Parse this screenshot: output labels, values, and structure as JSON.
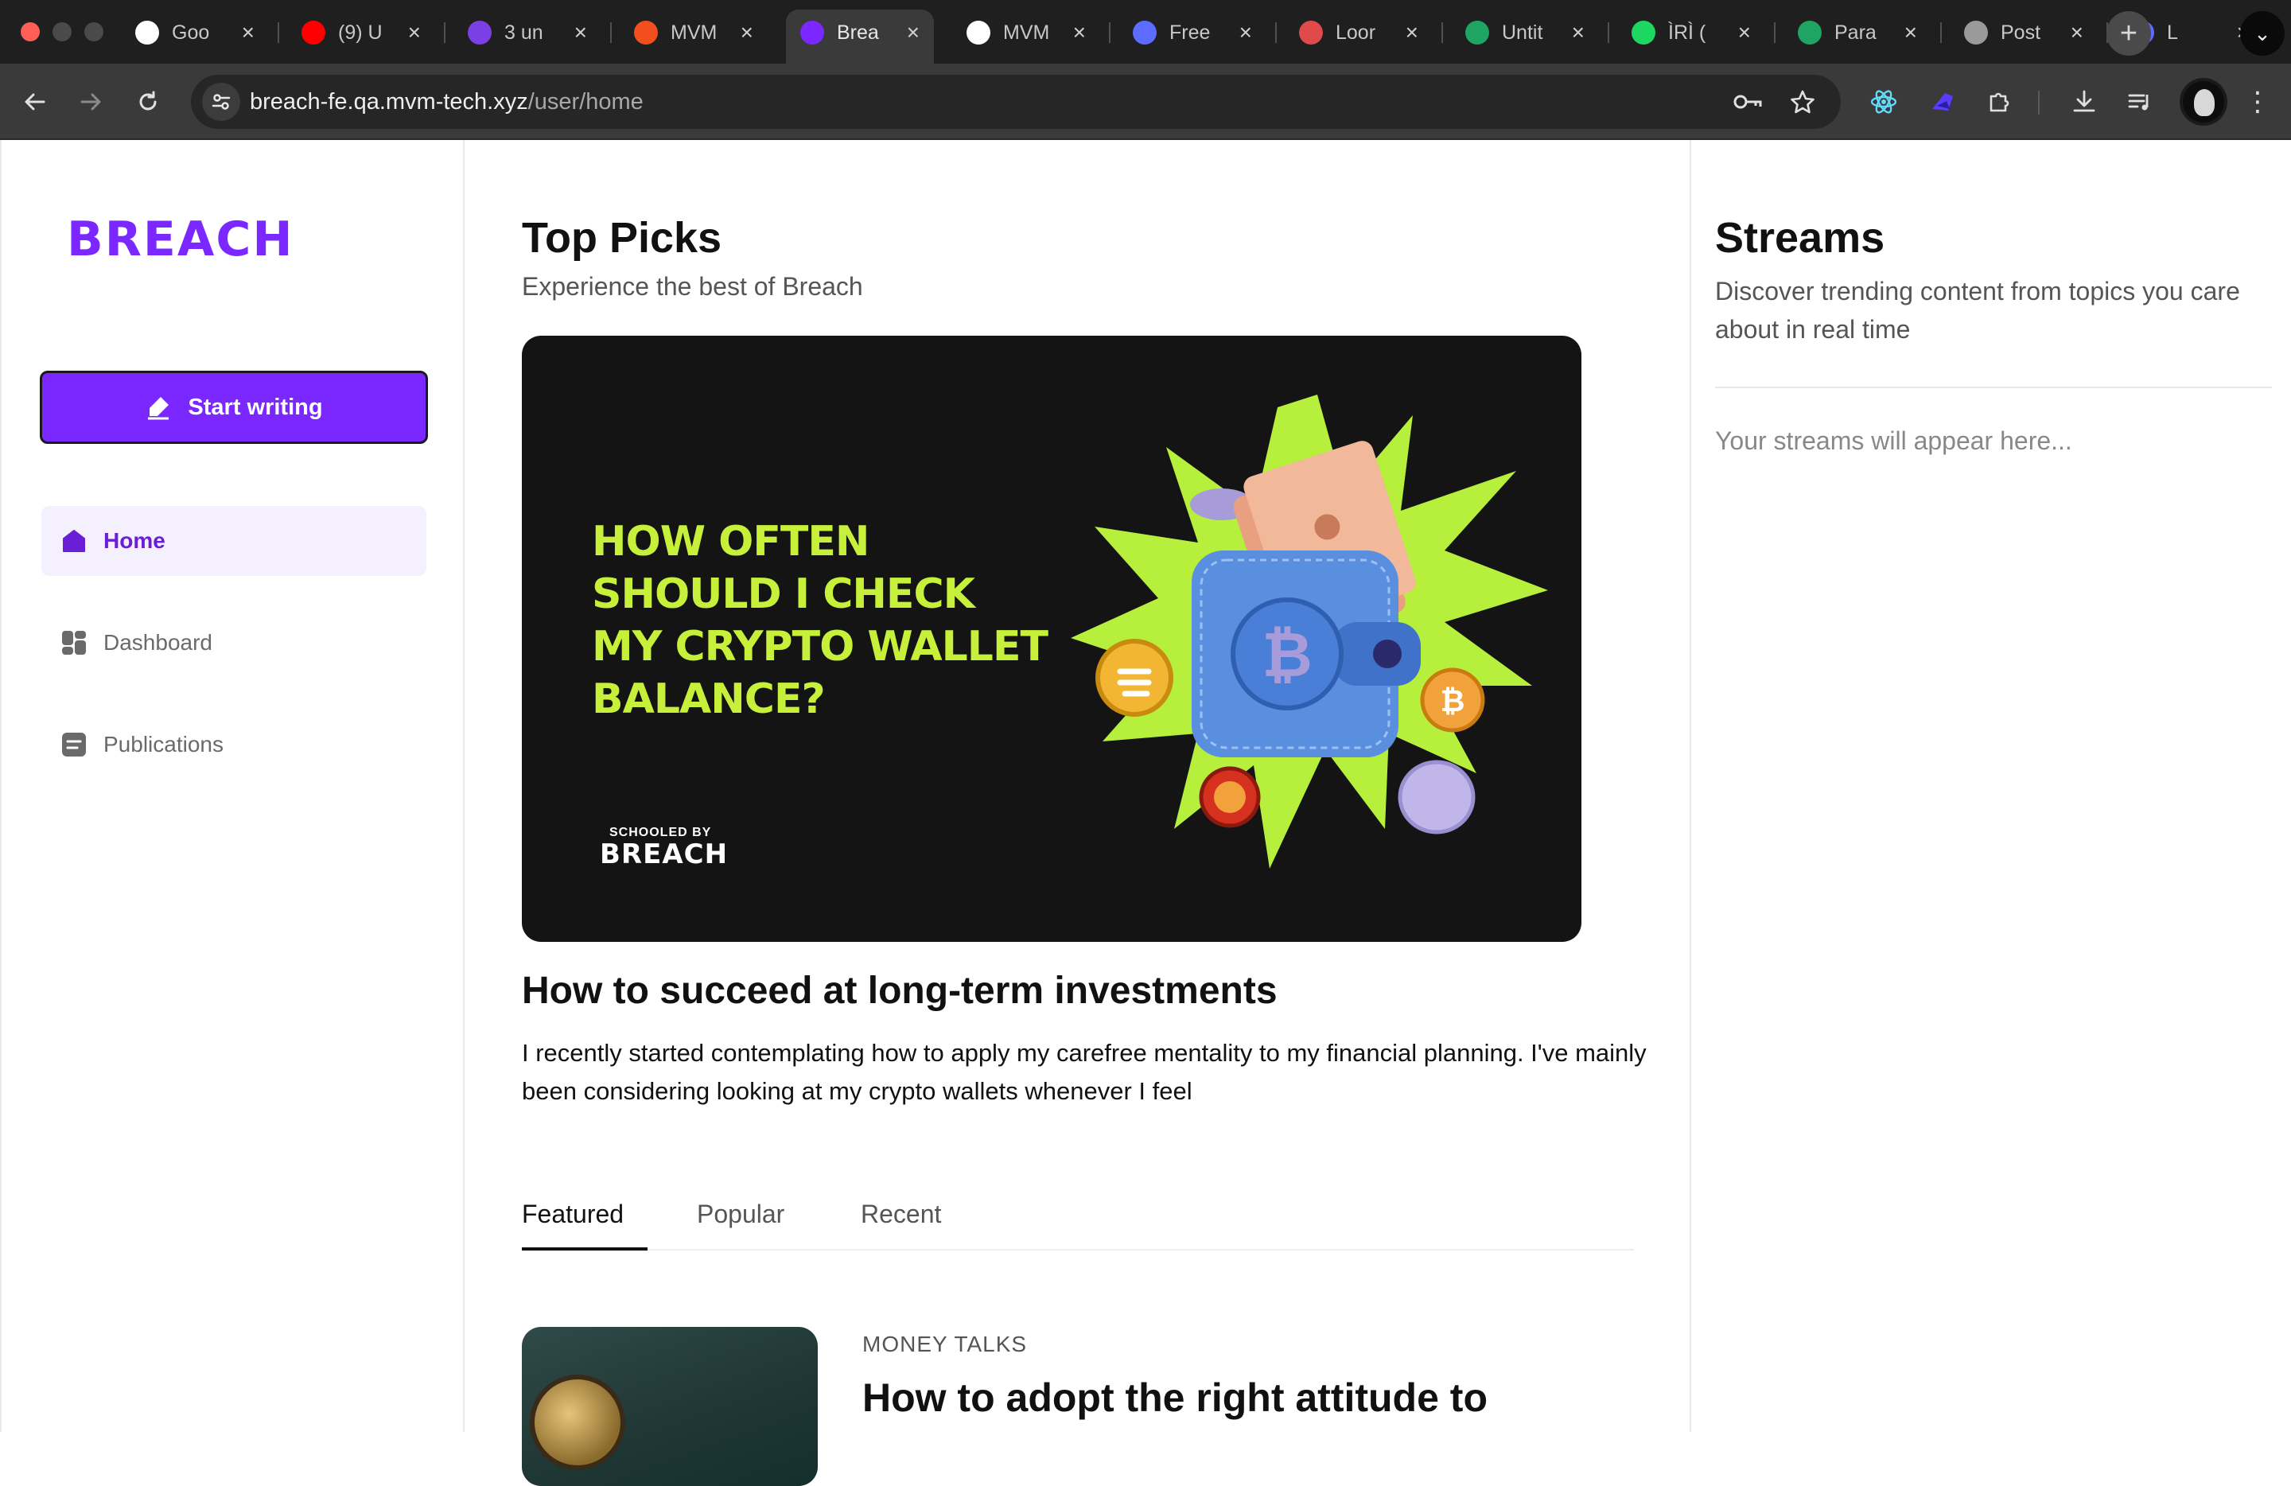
{
  "browser": {
    "tabs": [
      {
        "label": "Goo",
        "favicon": "google-icon",
        "color": "#ffffff"
      },
      {
        "label": "(9) U",
        "favicon": "youtube-icon",
        "color": "#ff0000"
      },
      {
        "label": "3 un",
        "favicon": "mail-icon",
        "color": "#7b3fe4"
      },
      {
        "label": "MVM",
        "favicon": "figma-icon",
        "color": "#f24e1e"
      },
      {
        "label": "Brea",
        "favicon": "breach-icon",
        "color": "#7a28ff"
      },
      {
        "label": "MVM",
        "favicon": "openai-icon",
        "color": "#ffffff"
      },
      {
        "label": "Free",
        "favicon": "gear-icon",
        "color": "#5b6cff"
      },
      {
        "label": "Loor",
        "favicon": "rainbow-icon",
        "color": "#e04a4a"
      },
      {
        "label": "Untit",
        "favicon": "sheets-icon",
        "color": "#1fa463"
      },
      {
        "label": "ÌRÌ (",
        "favicon": "spotify-icon",
        "color": "#1ed760"
      },
      {
        "label": "Para",
        "favicon": "docs-icon",
        "color": "#1fa463"
      },
      {
        "label": "Post",
        "favicon": "globe-icon",
        "color": "#9a9a9a"
      },
      {
        "label": "L",
        "favicon": "gear-icon",
        "color": "#5b6cff"
      }
    ],
    "url_host": "breach-fe.qa.mvm-tech.xyz",
    "url_path": "/user/home"
  },
  "sidebar": {
    "logo": "BREACH",
    "start_writing": "Start writing",
    "items": [
      {
        "label": "Home",
        "icon": "home-icon"
      },
      {
        "label": "Dashboard",
        "icon": "dashboard-icon"
      },
      {
        "label": "Publications",
        "icon": "publications-icon"
      }
    ]
  },
  "main": {
    "title": "Top Picks",
    "subtitle": "Experience the best of Breach",
    "hero": {
      "headline_lines": [
        "HOW OFTEN",
        "SHOULD I CHECK",
        "MY CRYPTO WALLET",
        "BALANCE?"
      ],
      "brand_small": "SCHOOLED BY",
      "brand": "BREACH"
    },
    "article": {
      "title": "How to succeed at long-term investments",
      "excerpt": "I recently started contemplating how to apply my carefree mentality to my financial planning. I've mainly been considering looking at my crypto wallets whenever I feel"
    },
    "tabs": [
      "Featured",
      "Popular",
      "Recent"
    ],
    "card": {
      "category": "MONEY TALKS",
      "title": "How to adopt the right attitude to"
    }
  },
  "streams": {
    "title": "Streams",
    "subtitle": "Discover trending content from topics you care about in real time",
    "empty": "Your streams will appear here..."
  },
  "colors": {
    "brand": "#7a28ff",
    "hero_text": "#c7f03a",
    "hero_bg": "#141414"
  }
}
